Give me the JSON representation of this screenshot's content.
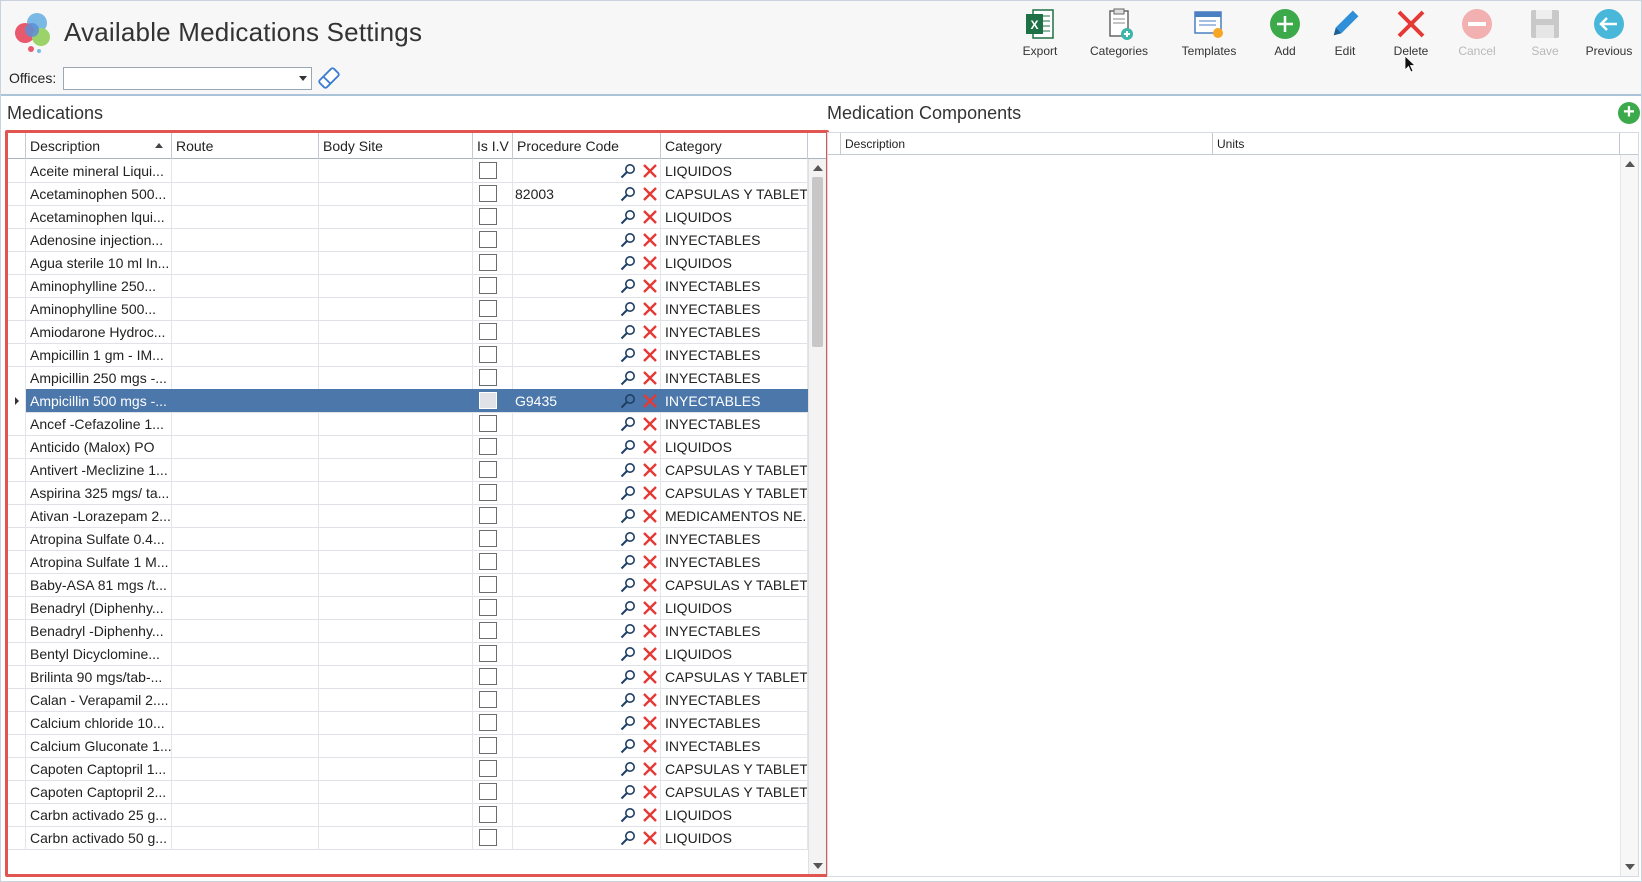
{
  "window": {
    "title": "Available Medications Settings"
  },
  "offices": {
    "label": "Offices:",
    "value": ""
  },
  "toolbar": {
    "export": "Export",
    "categories": "Categories",
    "templates": "Templates",
    "add": "Add",
    "edit": "Edit",
    "delete": "Delete",
    "cancel": "Cancel",
    "save": "Save",
    "previous": "Previous"
  },
  "medications": {
    "title": "Medications",
    "columns": {
      "description": "Description",
      "route": "Route",
      "body_site": "Body Site",
      "is_iv": "Is I.V",
      "procedure_code": "Procedure Code",
      "category": "Category"
    },
    "rows": [
      {
        "description": "Aceite mineral Liqui...",
        "code": "",
        "category": "LIQUIDOS"
      },
      {
        "description": "Acetaminophen 500...",
        "code": "82003",
        "category": "CAPSULAS Y TABLET..."
      },
      {
        "description": "Acetaminophen lqui...",
        "code": "",
        "category": "LIQUIDOS"
      },
      {
        "description": "Adenosine injection...",
        "code": "",
        "category": "INYECTABLES"
      },
      {
        "description": "Agua sterile 10 ml In...",
        "code": "",
        "category": "LIQUIDOS"
      },
      {
        "description": "Aminophylline 250...",
        "code": "",
        "category": "INYECTABLES"
      },
      {
        "description": "Aminophylline 500...",
        "code": "",
        "category": "INYECTABLES"
      },
      {
        "description": "Amiodarone Hydroc...",
        "code": "",
        "category": "INYECTABLES"
      },
      {
        "description": "Ampicillin 1 gm - IM...",
        "code": "",
        "category": "INYECTABLES"
      },
      {
        "description": "Ampicillin 250 mgs -...",
        "code": "",
        "category": "INYECTABLES"
      },
      {
        "description": "Ampicillin 500 mgs -...",
        "code": "G9435",
        "category": "INYECTABLES",
        "selected": true
      },
      {
        "description": "Ancef -Cefazoline  1...",
        "code": "",
        "category": "INYECTABLES"
      },
      {
        "description": "Anticido (Malox) PO",
        "code": "",
        "category": "LIQUIDOS"
      },
      {
        "description": "Antivert -Meclizine 1...",
        "code": "",
        "category": "CAPSULAS Y TABLET..."
      },
      {
        "description": "Aspirina 325 mgs/ ta...",
        "code": "",
        "category": "CAPSULAS Y TABLET..."
      },
      {
        "description": "Ativan -Lorazepam 2...",
        "code": "",
        "category": "MEDICAMENTOS NE..."
      },
      {
        "description": "Atropina Sulfate 0.4...",
        "code": "",
        "category": "INYECTABLES"
      },
      {
        "description": "Atropina Sulfate 1 M...",
        "code": "",
        "category": "INYECTABLES"
      },
      {
        "description": "Baby-ASA 81 mgs /t...",
        "code": "",
        "category": "CAPSULAS Y TABLET..."
      },
      {
        "description": "Benadryl (Diphenhy...",
        "code": "",
        "category": "LIQUIDOS"
      },
      {
        "description": "Benadryl -Diphenhy...",
        "code": "",
        "category": "INYECTABLES"
      },
      {
        "description": "Bentyl Dicyclomine...",
        "code": "",
        "category": "LIQUIDOS"
      },
      {
        "description": "Brilinta 90 mgs/tab-...",
        "code": "",
        "category": "CAPSULAS Y TABLET..."
      },
      {
        "description": "Calan - Verapamil 2....",
        "code": "",
        "category": "INYECTABLES"
      },
      {
        "description": "Calcium chloride 10...",
        "code": "",
        "category": "INYECTABLES"
      },
      {
        "description": "Calcium Gluconate 1...",
        "code": "",
        "category": "INYECTABLES"
      },
      {
        "description": "Capoten Captopril 1...",
        "code": "",
        "category": "CAPSULAS Y TABLET..."
      },
      {
        "description": "Capoten Captopril 2...",
        "code": "",
        "category": "CAPSULAS Y TABLET..."
      },
      {
        "description": "Carbn activado 25 g...",
        "code": "",
        "category": "LIQUIDOS"
      },
      {
        "description": "Carbn activado 50 g...",
        "code": "",
        "category": "LIQUIDOS"
      }
    ]
  },
  "components": {
    "title": "Medication Components",
    "columns": {
      "description": "Description",
      "units": "Units"
    }
  },
  "colors": {
    "selection": "#4c77ab",
    "highlight_border": "#e0554f",
    "add_green": "#3caa4a",
    "delete_red": "#e53935"
  }
}
